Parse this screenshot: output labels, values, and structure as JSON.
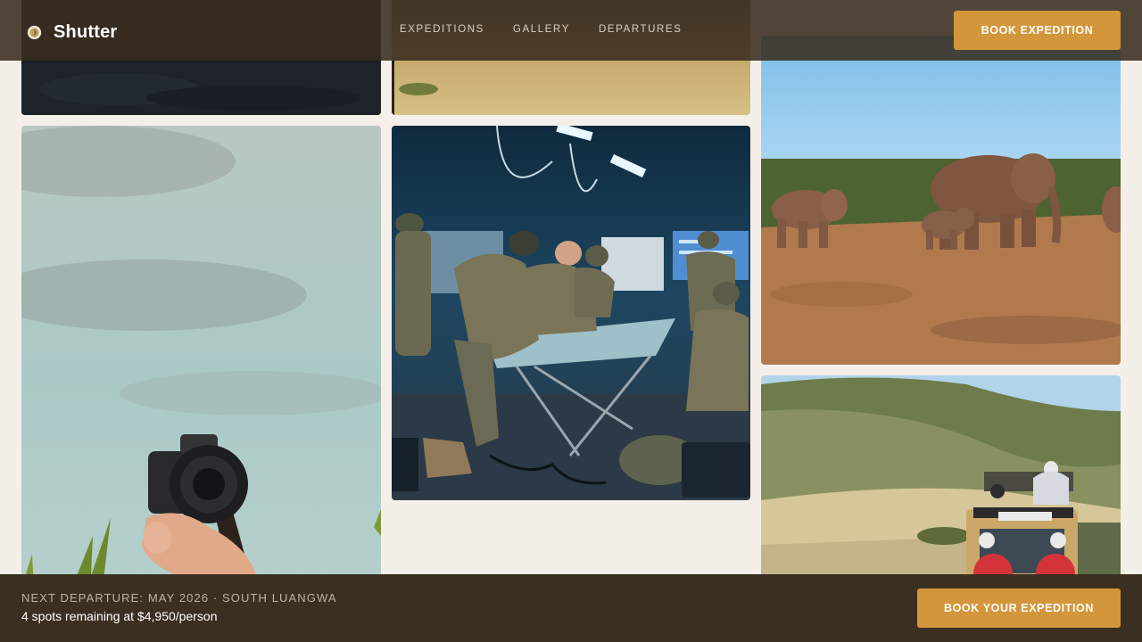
{
  "brand": {
    "name": "Shutter",
    "logo_icon": "shutter-logo-icon"
  },
  "nav": {
    "items": [
      {
        "label": "EXPEDITIONS"
      },
      {
        "label": "GALLERY"
      },
      {
        "label": "DEPARTURES"
      }
    ]
  },
  "header": {
    "cta_label": "BOOK EXPEDITION"
  },
  "gallery": {
    "photos": [
      {
        "subject": "dark-night-scene"
      },
      {
        "subject": "grassland-savanna"
      },
      {
        "subject": "hand-holding-camera"
      },
      {
        "subject": "soldiers-planning-map"
      },
      {
        "subject": "elephants-savanna"
      },
      {
        "subject": "safari-vehicle-hills"
      }
    ]
  },
  "footer": {
    "kicker": "NEXT DEPARTURE: MAY 2026 · SOUTH LUANGWA",
    "availability": "4 spots remaining at $4,950/person",
    "cta_label": "BOOK YOUR EXPEDITION"
  },
  "colors": {
    "accent": "#d4963a",
    "header_bg": "#3a2d20",
    "footer_bg": "#3b2f22",
    "page_bg": "#f5efe9"
  }
}
